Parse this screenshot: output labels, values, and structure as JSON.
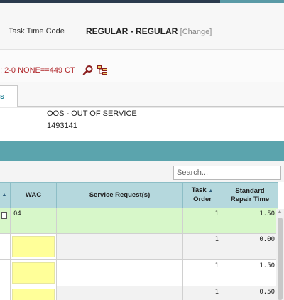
{
  "task_time": {
    "label": "Task Time Code",
    "value": "REGULAR - REGULAR",
    "change_link": "[Change]"
  },
  "path": {
    "text": "; 2-0 NONE==449 CT"
  },
  "tab": {
    "label": "s"
  },
  "info": {
    "line1": "OOS - OUT OF SERVICE",
    "line2": "1493141"
  },
  "search": {
    "placeholder": "Search..."
  },
  "table": {
    "headers": {
      "wac": "WAC",
      "service_request": "Service Request(s)",
      "task_order": "Task Order",
      "task_order_line1": "Task",
      "task_order_line2": "Order",
      "std_repair_line1": "Standard",
      "std_repair_line2": "Repair Time"
    },
    "rows": [
      {
        "wac": "04",
        "service_request": "",
        "task_order": "1",
        "repair_time": "1.50"
      },
      {
        "wac": "",
        "service_request": "",
        "task_order": "1",
        "repair_time": "0.00"
      },
      {
        "wac": "",
        "service_request": "",
        "task_order": "1",
        "repair_time": "1.50"
      },
      {
        "wac": "",
        "service_request": "",
        "task_order": "1",
        "repair_time": "0.50"
      }
    ]
  },
  "colors": {
    "accent_teal": "#5ba4ad",
    "header_bg": "#b5d8dd",
    "row_highlight": "#d7f7c9",
    "wac_empty": "#ffff99",
    "path_red": "#b0262a"
  }
}
